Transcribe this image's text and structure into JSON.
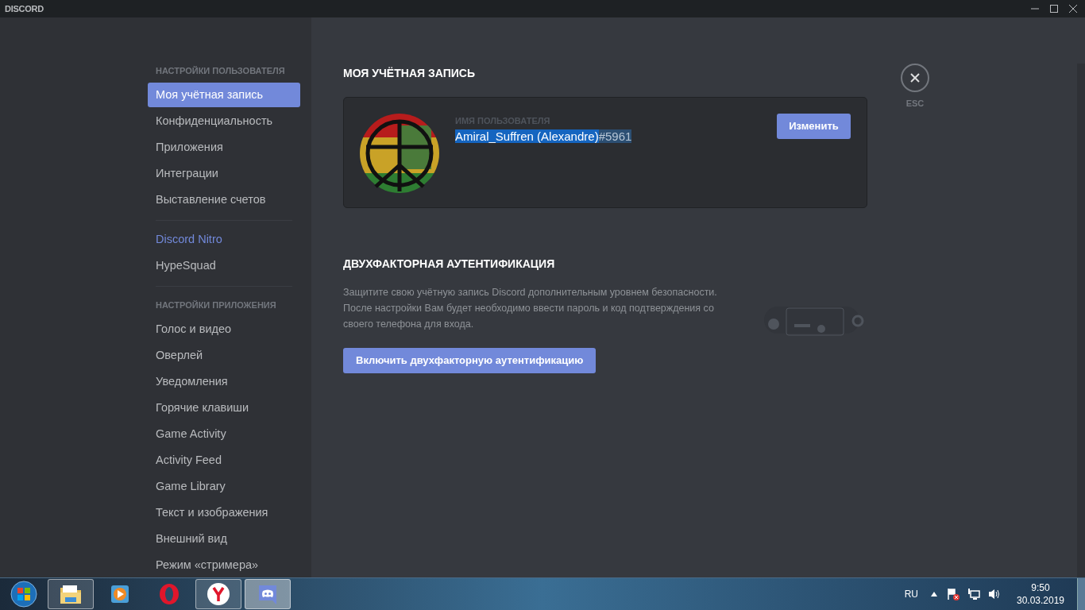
{
  "window": {
    "title": "DISCORD"
  },
  "sidebar": {
    "items": [
      {
        "kind": "header",
        "label": "НАСТРОЙКИ ПОЛЬЗОВАТЕЛЯ"
      },
      {
        "kind": "item",
        "label": "Моя учётная запись",
        "selected": true
      },
      {
        "kind": "item",
        "label": "Конфиденциальность",
        "selected": false
      },
      {
        "kind": "item",
        "label": "Приложения",
        "selected": false
      },
      {
        "kind": "item",
        "label": "Интеграции",
        "selected": false
      },
      {
        "kind": "item",
        "label": "Выставление счетов",
        "selected": false
      },
      {
        "kind": "divider"
      },
      {
        "kind": "nitro",
        "label": "Discord Nitro",
        "selected": false
      },
      {
        "kind": "item",
        "label": "HypeSquad",
        "selected": false
      },
      {
        "kind": "divider"
      },
      {
        "kind": "header",
        "label": "НАСТРОЙКИ ПРИЛОЖЕНИЯ"
      },
      {
        "kind": "item",
        "label": "Голос и видео",
        "selected": false
      },
      {
        "kind": "item",
        "label": "Оверлей",
        "selected": false
      },
      {
        "kind": "item",
        "label": "Уведомления",
        "selected": false
      },
      {
        "kind": "item",
        "label": "Горячие клавиши",
        "selected": false
      },
      {
        "kind": "item",
        "label": "Game Activity",
        "selected": false
      },
      {
        "kind": "item",
        "label": "Activity Feed",
        "selected": false
      },
      {
        "kind": "item",
        "label": "Game Library",
        "selected": false
      },
      {
        "kind": "item",
        "label": "Текст и изображения",
        "selected": false
      },
      {
        "kind": "item",
        "label": "Внешний вид",
        "selected": false
      },
      {
        "kind": "item",
        "label": "Режим «стримера»",
        "selected": false
      }
    ]
  },
  "account": {
    "title": "МОЯ УЧЁТНАЯ ЗАПИСЬ",
    "username_label": "ИМЯ ПОЛЬЗОВАТЕЛЯ",
    "username": "Amiral_Suffren (Alexandre)",
    "discriminator": "#5961",
    "text_selected": true,
    "edit_button": "Изменить"
  },
  "two_factor": {
    "title": "ДВУХФАКТОРНАЯ АУТЕНТИФИКАЦИЯ",
    "description": "Защитите свою учётную запись Discord дополнительным уровнем безопасности. После настройки Вам будет необходимо ввести пароль и код подтверждения со своего телефона для входа.",
    "button": "Включить двухфакторную аутентификацию"
  },
  "close": {
    "label": "ESC"
  },
  "taskbar": {
    "apps": [
      {
        "kind": "explorer",
        "running": true,
        "selected": false
      },
      {
        "kind": "player",
        "running": false,
        "selected": false
      },
      {
        "kind": "opera",
        "running": false,
        "selected": false
      },
      {
        "kind": "yandex",
        "running": true,
        "selected": false
      },
      {
        "kind": "discord",
        "running": true,
        "selected": true
      }
    ],
    "language": "RU",
    "time": "9:50",
    "date": "30.03.2019"
  }
}
